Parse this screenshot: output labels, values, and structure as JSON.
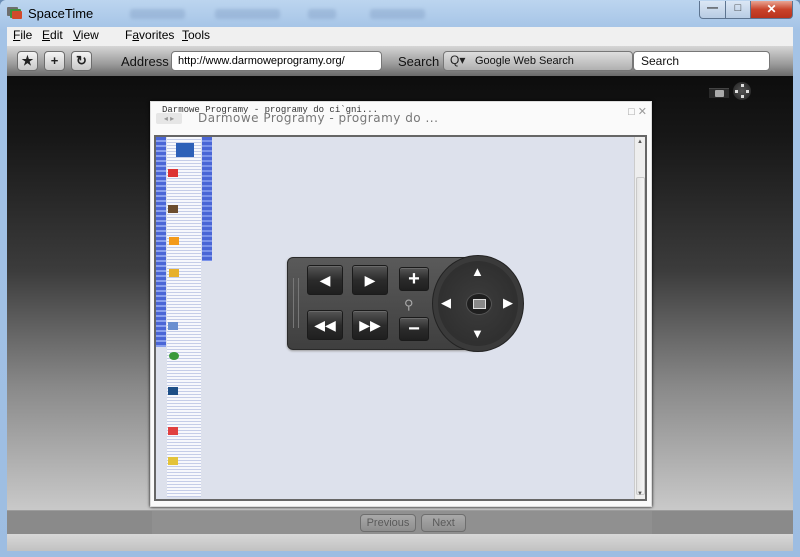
{
  "window": {
    "title": "SpaceTime",
    "controls": {
      "minimize": "—",
      "maximize": "□",
      "close": "✕"
    }
  },
  "menubar": {
    "items": [
      {
        "label": "File",
        "accel": "F",
        "rest": "ile"
      },
      {
        "label": "Edit",
        "accel": "E",
        "rest": "dit"
      },
      {
        "label": "View",
        "accel": "V",
        "rest": "iew"
      },
      {
        "label": "Favorites",
        "accel": "a",
        "pre": "F",
        "rest": "vorites"
      },
      {
        "label": "Tools",
        "accel": "T",
        "rest": "ools"
      }
    ]
  },
  "toolbar": {
    "buttons": [
      {
        "name": "favorite",
        "icon": "★"
      },
      {
        "name": "add",
        "icon": "+"
      },
      {
        "name": "refresh",
        "icon": "↻"
      }
    ],
    "address_label": "Address",
    "address_value": "http://www.darmoweprogramy.org/",
    "search_label": "Search",
    "search_engine_icon": "Q▾",
    "search_engine": "Google Web Search",
    "search_value": "Search"
  },
  "stage": {
    "card": {
      "small_title": "Darmowe Programy - programy do  ci`gni...",
      "large_title": "Darmowe Programy - programy do   ...",
      "nav_arrows": "◂ ▸",
      "card_icons": "□ ✕"
    },
    "controls": {
      "prev": "◀",
      "next": "▶",
      "rewind": "◀◀",
      "fast_forward": "▶▶",
      "zoom_in": "+",
      "zoom_out": "−",
      "zoom_icon": "🔍",
      "up": "▲",
      "down": "▼",
      "left": "◀",
      "right": "▶"
    }
  },
  "bottom": {
    "previous_label": "Previous",
    "next_label": "Next"
  }
}
